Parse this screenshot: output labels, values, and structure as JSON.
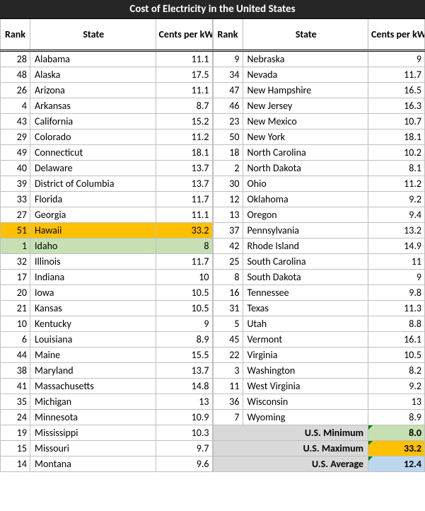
{
  "title": "Cost of Electricity in the United States",
  "headers": {
    "rank": "Rank",
    "state": "State",
    "value": "Cents per kW-hour"
  },
  "highlight": {
    "max_state": "Hawaii",
    "min_state": "Idaho"
  },
  "left": [
    {
      "rank": 28,
      "state": "Alabama",
      "val": "11.1"
    },
    {
      "rank": 48,
      "state": "Alaska",
      "val": "17.5"
    },
    {
      "rank": 26,
      "state": "Arizona",
      "val": "11.1"
    },
    {
      "rank": 4,
      "state": "Arkansas",
      "val": "8.7"
    },
    {
      "rank": 43,
      "state": "California",
      "val": "15.2"
    },
    {
      "rank": 29,
      "state": "Colorado",
      "val": "11.2"
    },
    {
      "rank": 49,
      "state": "Connecticut",
      "val": "18.1"
    },
    {
      "rank": 40,
      "state": "Delaware",
      "val": "13.7"
    },
    {
      "rank": 39,
      "state": "District of Columbia",
      "val": "13.7"
    },
    {
      "rank": 33,
      "state": "Florida",
      "val": "11.7"
    },
    {
      "rank": 27,
      "state": "Georgia",
      "val": "11.1"
    },
    {
      "rank": 51,
      "state": "Hawaii",
      "val": "33.2"
    },
    {
      "rank": 1,
      "state": "Idaho",
      "val": "8"
    },
    {
      "rank": 32,
      "state": "Illinois",
      "val": "11.7"
    },
    {
      "rank": 17,
      "state": "Indiana",
      "val": "10"
    },
    {
      "rank": 20,
      "state": "Iowa",
      "val": "10.5"
    },
    {
      "rank": 21,
      "state": "Kansas",
      "val": "10.5"
    },
    {
      "rank": 10,
      "state": "Kentucky",
      "val": "9"
    },
    {
      "rank": 6,
      "state": "Louisiana",
      "val": "8.9"
    },
    {
      "rank": 44,
      "state": "Maine",
      "val": "15.5"
    },
    {
      "rank": 38,
      "state": "Maryland",
      "val": "13.7"
    },
    {
      "rank": 41,
      "state": "Massachusetts",
      "val": "14.8"
    },
    {
      "rank": 35,
      "state": "Michigan",
      "val": "13"
    },
    {
      "rank": 24,
      "state": "Minnesota",
      "val": "10.9"
    },
    {
      "rank": 19,
      "state": "Mississippi",
      "val": "10.3"
    },
    {
      "rank": 15,
      "state": "Missouri",
      "val": "9.7"
    },
    {
      "rank": 14,
      "state": "Montana",
      "val": "9.6"
    }
  ],
  "right": [
    {
      "rank": 9,
      "state": "Nebraska",
      "val": "9"
    },
    {
      "rank": 34,
      "state": "Nevada",
      "val": "11.7"
    },
    {
      "rank": 47,
      "state": "New Hampshire",
      "val": "16.5"
    },
    {
      "rank": 46,
      "state": "New Jersey",
      "val": "16.3"
    },
    {
      "rank": 23,
      "state": "New Mexico",
      "val": "10.7"
    },
    {
      "rank": 50,
      "state": "New York",
      "val": "18.1"
    },
    {
      "rank": 18,
      "state": "North Carolina",
      "val": "10.2"
    },
    {
      "rank": 2,
      "state": "North Dakota",
      "val": "8.1"
    },
    {
      "rank": 30,
      "state": "Ohio",
      "val": "11.2"
    },
    {
      "rank": 12,
      "state": "Oklahoma",
      "val": "9.2"
    },
    {
      "rank": 13,
      "state": "Oregon",
      "val": "9.4"
    },
    {
      "rank": 37,
      "state": "Pennsylvania",
      "val": "13.2"
    },
    {
      "rank": 42,
      "state": "Rhode Island",
      "val": "14.9"
    },
    {
      "rank": 25,
      "state": "South Carolina",
      "val": "11"
    },
    {
      "rank": 8,
      "state": "South Dakota",
      "val": "9"
    },
    {
      "rank": 16,
      "state": "Tennessee",
      "val": "9.8"
    },
    {
      "rank": 31,
      "state": "Texas",
      "val": "11.3"
    },
    {
      "rank": 5,
      "state": "Utah",
      "val": "8.8"
    },
    {
      "rank": 45,
      "state": "Vermont",
      "val": "16.1"
    },
    {
      "rank": 22,
      "state": "Virginia",
      "val": "10.5"
    },
    {
      "rank": 3,
      "state": "Washington",
      "val": "8.2"
    },
    {
      "rank": 11,
      "state": "West Virginia",
      "val": "9.2"
    },
    {
      "rank": 36,
      "state": "Wisconsin",
      "val": "13"
    },
    {
      "rank": 7,
      "state": "Wyoming",
      "val": "8.9"
    }
  ],
  "summary": {
    "min": {
      "label": "U.S. Minimum",
      "val": "8.0"
    },
    "max": {
      "label": "U.S. Maximum",
      "val": "33.2"
    },
    "avg": {
      "label": "U.S. Average",
      "val": "12.4"
    }
  }
}
